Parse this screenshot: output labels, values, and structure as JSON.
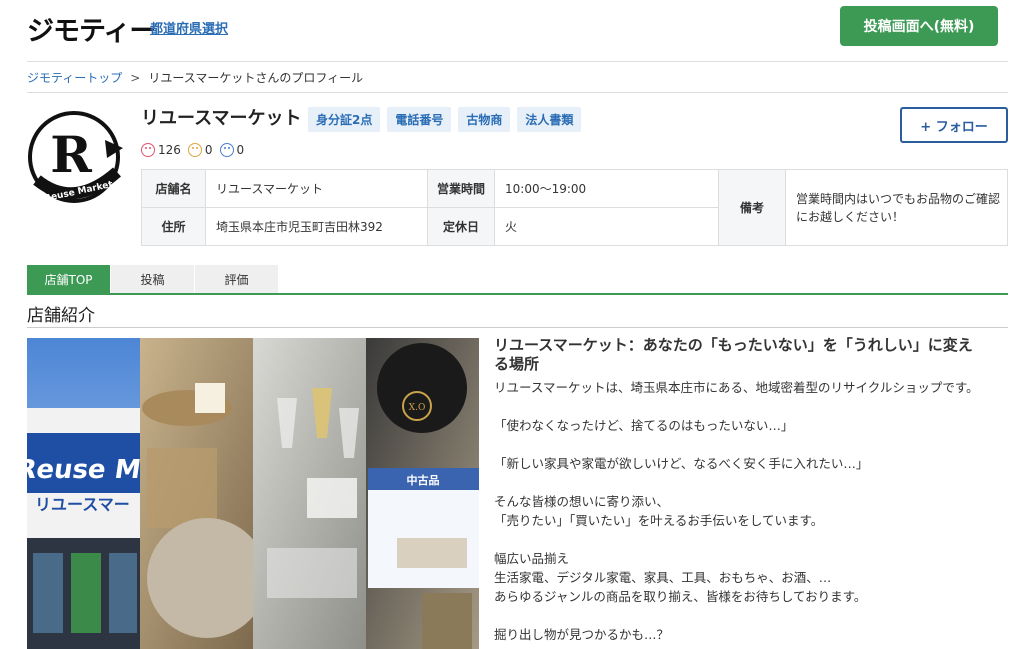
{
  "header": {
    "logo": "ジモティー",
    "pref_link": "都道府県選択",
    "post_button": "投稿画面へ(無料)"
  },
  "breadcrumb": {
    "home": "ジモティートップ",
    "separator": ">",
    "current": "リユースマーケットさんのプロフィール"
  },
  "profile": {
    "name": "リユースマーケット",
    "badges": [
      "身分証2点",
      "電話番号",
      "古物商",
      "法人書類"
    ],
    "ratings": {
      "good": "126",
      "neutral": "0",
      "bad": "0"
    },
    "follow_button": "+ フォロー",
    "logo_text": {
      "letter": "R",
      "sub": "Reuse Market"
    }
  },
  "info": {
    "store_name_label": "店舗名",
    "store_name": "リユースマーケット",
    "hours_label": "営業時間",
    "hours": "10:00〜19:00",
    "address_label": "住所",
    "address": "埼玉県本庄市児玉町吉田林392",
    "closed_label": "定休日",
    "closed": "火",
    "note_label": "備考",
    "note_line1": "営業時間内はいつでもお品物のご確認",
    "note_line2": "にお越しください！"
  },
  "tabs": [
    {
      "label": "店舗TOP",
      "active": true
    },
    {
      "label": "投稿",
      "active": false
    },
    {
      "label": "評価",
      "active": false
    }
  ],
  "section_title": "店舗紹介",
  "photo": {
    "sign_text": "Reuse M",
    "sign_sub": "リユースマー",
    "price_label": "中古品",
    "xo_label": "X.O"
  },
  "intro": {
    "title_line1": "リユースマーケット：あなたの「もったいない」を「うれしい」に変え",
    "title_line2": "る場所",
    "lines": [
      "リユースマーケットは、埼玉県本庄市にある、地域密着型のリサイクルショップです。",
      "",
      "「使わなくなったけど、捨てるのはもったいない…」",
      "",
      "「新しい家具や家電が欲しいけど、なるべく安く手に入れたい…」",
      "",
      "そんな皆様の想いに寄り添い、",
      "「売りたい」「買いたい」を叶えるお手伝いをしています。",
      "",
      "幅広い品揃え",
      "生活家電、デジタル家電、家具、工具、おもちゃ、お酒、…",
      "あらゆるジャンルの商品を取り揃え、皆様をお待ちしております。",
      "",
      "掘り出し物が見つかるかも…？"
    ]
  },
  "colors": {
    "accent_green": "#3c9a54",
    "link_blue": "#2a6db5",
    "follow_blue": "#2a5c9e"
  }
}
